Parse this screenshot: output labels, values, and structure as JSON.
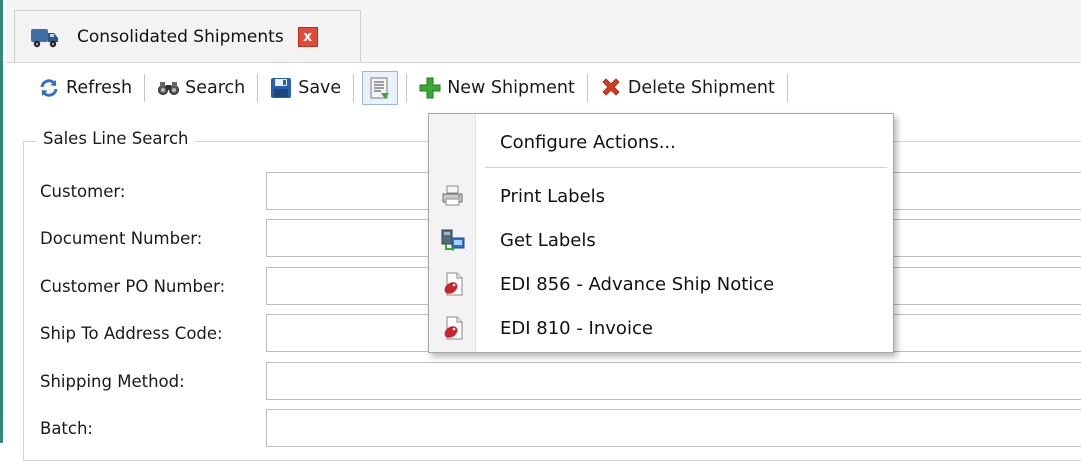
{
  "tab": {
    "title": "Consolidated Shipments",
    "close_glyph": "x",
    "icon": "truck-icon"
  },
  "toolbar": {
    "refresh_label": "Refresh",
    "search_label": "Search",
    "save_label": "Save",
    "new_shipment_label": "New Shipment",
    "delete_shipment_label": "Delete Shipment"
  },
  "search_group": {
    "caption": "Sales Line Search",
    "fields": [
      {
        "label": "Customer:",
        "value": ""
      },
      {
        "label": "Document Number:",
        "value": ""
      },
      {
        "label": "Customer PO Number:",
        "value": ""
      },
      {
        "label": "Ship To Address Code:",
        "value": ""
      },
      {
        "label": "Shipping Method:",
        "value": ""
      },
      {
        "label": "Batch:",
        "value": ""
      }
    ]
  },
  "actions_menu": {
    "configure_label": "Configure Actions...",
    "items": [
      {
        "label": "Print Labels",
        "icon": "printer-icon"
      },
      {
        "label": "Get Labels",
        "icon": "network-download-icon"
      },
      {
        "label": "EDI 856 - Advance Ship Notice",
        "icon": "edi-document-icon"
      },
      {
        "label": "EDI 810 - Invoice",
        "icon": "edi-document-icon"
      }
    ]
  },
  "colors": {
    "accent_border": "#2e8a72",
    "close_red": "#e04a3a",
    "delete_red": "#d93a22",
    "add_green": "#3aa832"
  }
}
